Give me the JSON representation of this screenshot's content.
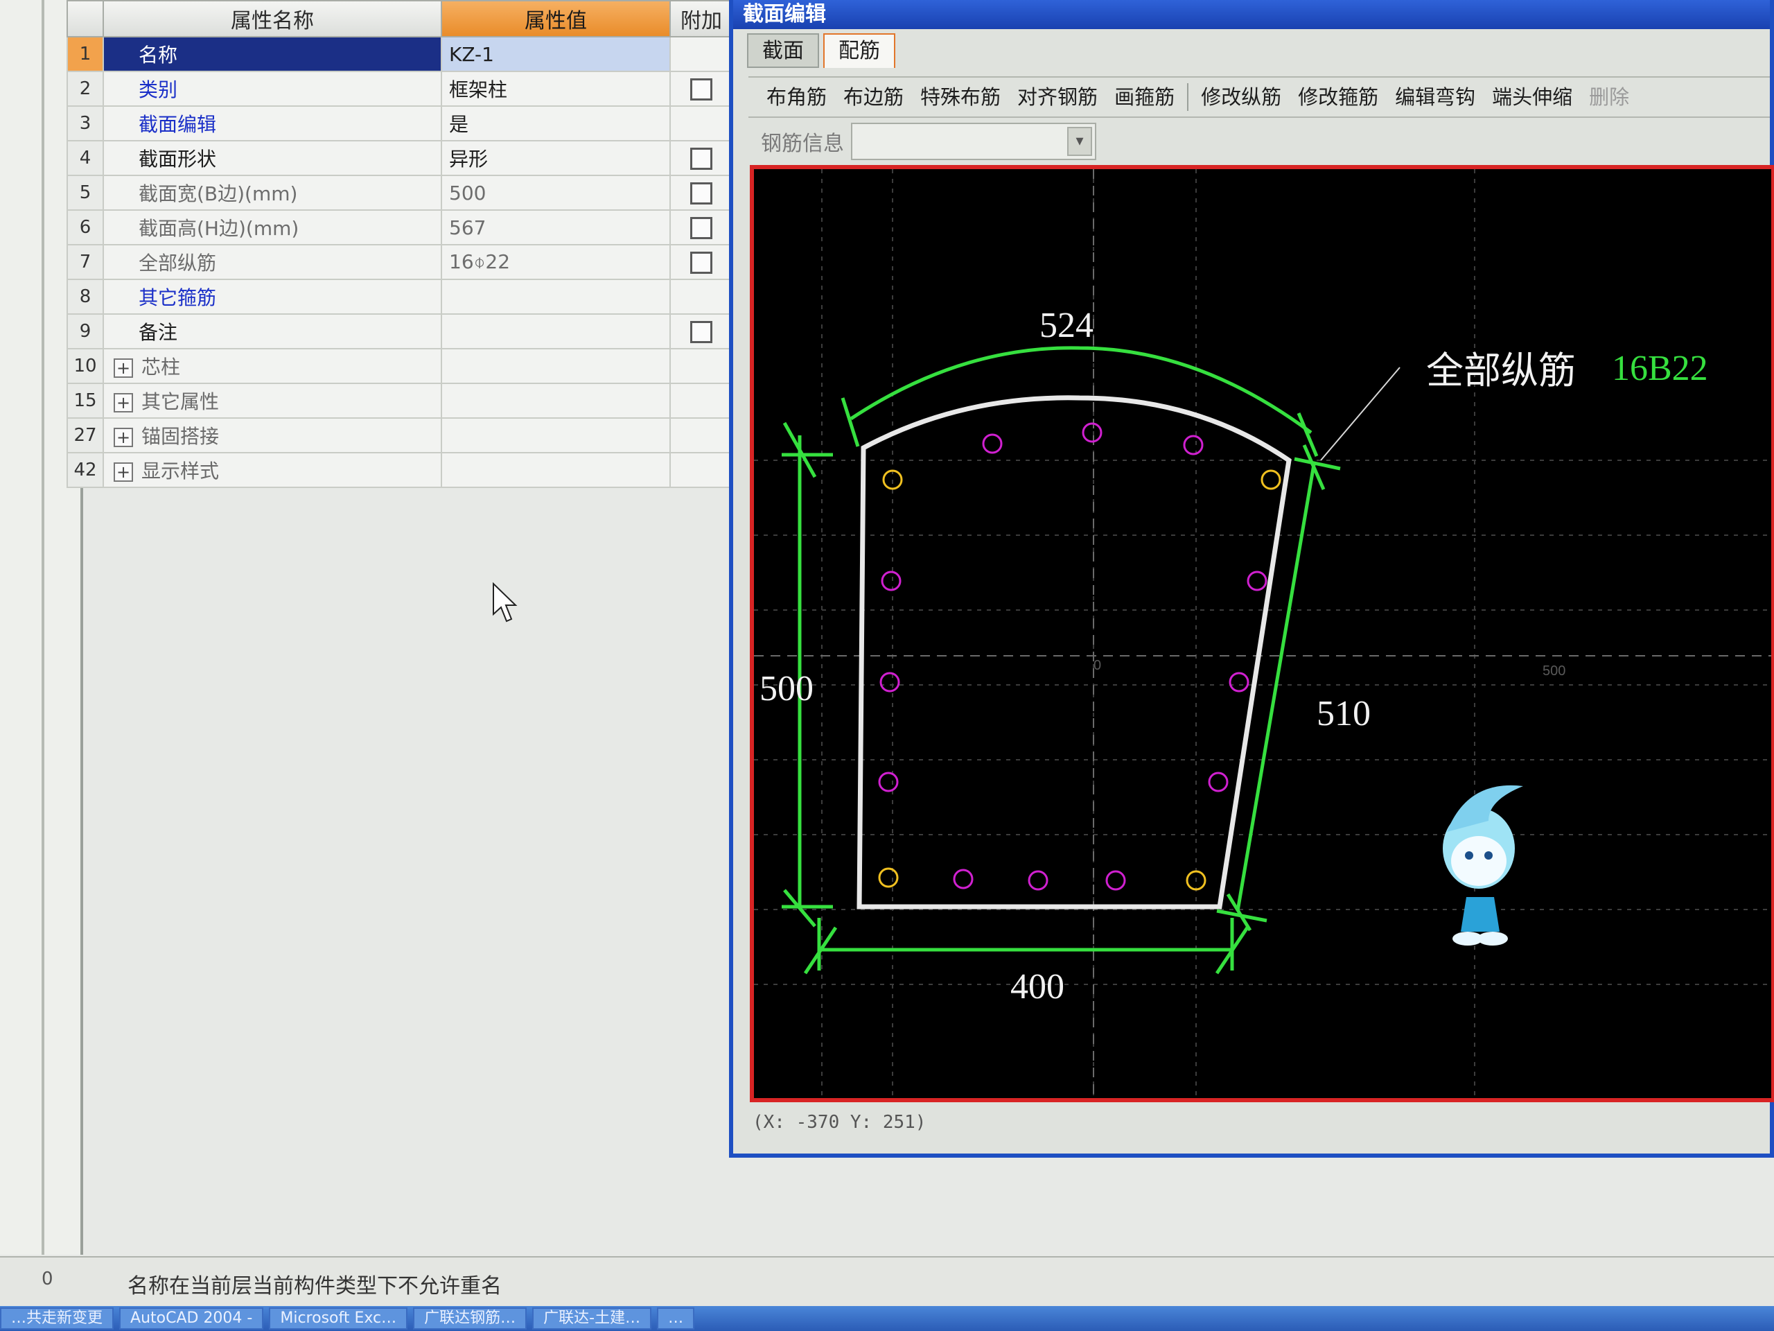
{
  "property_grid": {
    "columns": [
      "属性名称",
      "属性值",
      "附加"
    ],
    "rows": [
      {
        "num": "1",
        "name": "名称",
        "value": "KZ-1",
        "has_checkbox": false
      },
      {
        "num": "2",
        "name": "类别",
        "value": "框架柱",
        "has_checkbox": true
      },
      {
        "num": "3",
        "name": "截面编辑",
        "value": "是",
        "has_checkbox": false
      },
      {
        "num": "4",
        "name": "截面形状",
        "value": "异形",
        "has_checkbox": true
      },
      {
        "num": "5",
        "name": "截面宽(B边)(mm)",
        "value": "500",
        "has_checkbox": true
      },
      {
        "num": "6",
        "name": "截面高(H边)(mm)",
        "value": "567",
        "has_checkbox": true
      },
      {
        "num": "7",
        "name": "全部纵筋",
        "value": "16⌽22",
        "has_checkbox": true
      },
      {
        "num": "8",
        "name": "其它箍筋",
        "value": "",
        "has_checkbox": false
      },
      {
        "num": "9",
        "name": "备注",
        "value": "",
        "has_checkbox": true
      }
    ],
    "groups": [
      {
        "num": "10",
        "name": "芯柱"
      },
      {
        "num": "15",
        "name": "其它属性"
      },
      {
        "num": "27",
        "name": "锚固搭接"
      },
      {
        "num": "42",
        "name": "显示样式"
      }
    ]
  },
  "editor": {
    "title": "截面编辑",
    "tabs": [
      "截面",
      "配筋"
    ],
    "active_tab": "配筋",
    "toolbar": [
      "布角筋",
      "布边筋",
      "特殊布筋",
      "对齐钢筋",
      "画箍筋",
      "修改纵筋",
      "修改箍筋",
      "编辑弯钩",
      "端头伸缩",
      "删除"
    ],
    "disabled_tool": "删除",
    "rebar_info_label": "钢筋信息",
    "rebar_info_value": "",
    "coord_readout": "(X: -370 Y: 251)"
  },
  "drawing": {
    "dimensions": {
      "top": "524",
      "left": "500",
      "right": "510",
      "bottom": "400"
    },
    "annotation_label": "全部纵筋",
    "annotation_value": "16B22",
    "axis_origin_label": "0",
    "axis_tick_label": "500",
    "colors": {
      "outline": "#e8e8e8",
      "dimension": "#36e03f",
      "corner_bar": "#f0c020",
      "side_bar": "#d020d0",
      "frame": "#d82424"
    },
    "mascot_icon": "mascot-icon"
  },
  "status": {
    "index": "0",
    "message": "名称在当前层当前构件类型下不允许重名"
  },
  "taskbar": {
    "items": [
      "…共走新变更",
      "AutoCAD 2004 -",
      "Microsoft Exc…",
      "广联达钢筋…",
      "广联达-土建…",
      "…"
    ]
  }
}
